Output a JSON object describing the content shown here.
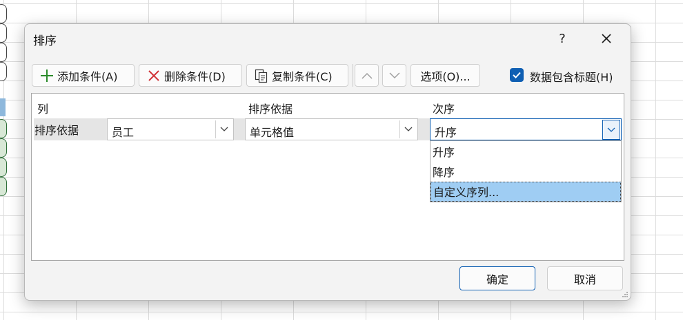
{
  "dialog": {
    "title": "排序",
    "help_label": "?",
    "close_icon": "close-icon"
  },
  "toolbar": {
    "add_label": "添加条件(A)",
    "delete_label": "删除条件(D)",
    "copy_label": "复制条件(C)",
    "move_up_icon": "chevron-up-icon",
    "move_down_icon": "chevron-down-icon",
    "options_label": "选项(O)...",
    "header_checkbox_label": "数据包含标题(H)",
    "header_checkbox_checked": true
  },
  "columns": {
    "col": "列",
    "sort_on": "排序依据",
    "order": "次序"
  },
  "row": {
    "label": "排序依据",
    "column_value": "员工",
    "sort_on_value": "单元格值",
    "order_value": "升序"
  },
  "order_dropdown": {
    "items": [
      "升序",
      "降序",
      "自定义序列..."
    ],
    "highlighted_index": 2
  },
  "footer": {
    "ok_label": "确定",
    "cancel_label": "取消"
  },
  "colors": {
    "accent": "#0f5fb3",
    "highlight": "#9fcdf3",
    "add_icon": "#2a8a2a",
    "delete_icon": "#d13438"
  }
}
